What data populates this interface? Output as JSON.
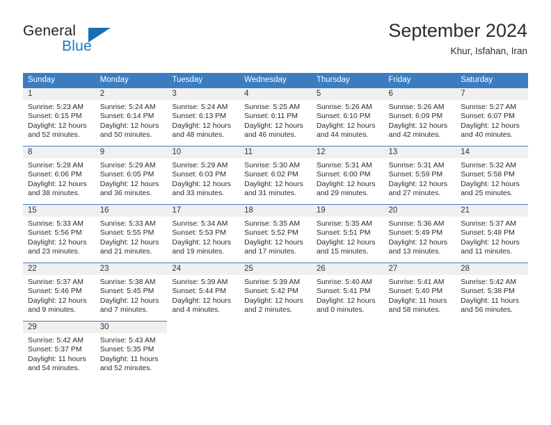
{
  "brand": {
    "name_part1": "General",
    "name_part2": "Blue",
    "triangle_color": "#1470b5",
    "blue_color": "#1579c6"
  },
  "header": {
    "title": "September 2024",
    "location": "Khur, Isfahan, Iran"
  },
  "theme": {
    "header_row_bg": "#3b7dc0",
    "header_row_text": "#ffffff",
    "daynum_band_bg": "#f0f0f0",
    "cell_border": "#3b7dc0",
    "body_text": "#2b2b2b"
  },
  "weekday_headers": [
    "Sunday",
    "Monday",
    "Tuesday",
    "Wednesday",
    "Thursday",
    "Friday",
    "Saturday"
  ],
  "weeks": [
    [
      {
        "day": "1",
        "sunrise": "Sunrise: 5:23 AM",
        "sunset": "Sunset: 6:15 PM",
        "daylight_line1": "Daylight: 12 hours",
        "daylight_line2": "and 52 minutes."
      },
      {
        "day": "2",
        "sunrise": "Sunrise: 5:24 AM",
        "sunset": "Sunset: 6:14 PM",
        "daylight_line1": "Daylight: 12 hours",
        "daylight_line2": "and 50 minutes."
      },
      {
        "day": "3",
        "sunrise": "Sunrise: 5:24 AM",
        "sunset": "Sunset: 6:13 PM",
        "daylight_line1": "Daylight: 12 hours",
        "daylight_line2": "and 48 minutes."
      },
      {
        "day": "4",
        "sunrise": "Sunrise: 5:25 AM",
        "sunset": "Sunset: 6:11 PM",
        "daylight_line1": "Daylight: 12 hours",
        "daylight_line2": "and 46 minutes."
      },
      {
        "day": "5",
        "sunrise": "Sunrise: 5:26 AM",
        "sunset": "Sunset: 6:10 PM",
        "daylight_line1": "Daylight: 12 hours",
        "daylight_line2": "and 44 minutes."
      },
      {
        "day": "6",
        "sunrise": "Sunrise: 5:26 AM",
        "sunset": "Sunset: 6:09 PM",
        "daylight_line1": "Daylight: 12 hours",
        "daylight_line2": "and 42 minutes."
      },
      {
        "day": "7",
        "sunrise": "Sunrise: 5:27 AM",
        "sunset": "Sunset: 6:07 PM",
        "daylight_line1": "Daylight: 12 hours",
        "daylight_line2": "and 40 minutes."
      }
    ],
    [
      {
        "day": "8",
        "sunrise": "Sunrise: 5:28 AM",
        "sunset": "Sunset: 6:06 PM",
        "daylight_line1": "Daylight: 12 hours",
        "daylight_line2": "and 38 minutes."
      },
      {
        "day": "9",
        "sunrise": "Sunrise: 5:29 AM",
        "sunset": "Sunset: 6:05 PM",
        "daylight_line1": "Daylight: 12 hours",
        "daylight_line2": "and 36 minutes."
      },
      {
        "day": "10",
        "sunrise": "Sunrise: 5:29 AM",
        "sunset": "Sunset: 6:03 PM",
        "daylight_line1": "Daylight: 12 hours",
        "daylight_line2": "and 33 minutes."
      },
      {
        "day": "11",
        "sunrise": "Sunrise: 5:30 AM",
        "sunset": "Sunset: 6:02 PM",
        "daylight_line1": "Daylight: 12 hours",
        "daylight_line2": "and 31 minutes."
      },
      {
        "day": "12",
        "sunrise": "Sunrise: 5:31 AM",
        "sunset": "Sunset: 6:00 PM",
        "daylight_line1": "Daylight: 12 hours",
        "daylight_line2": "and 29 minutes."
      },
      {
        "day": "13",
        "sunrise": "Sunrise: 5:31 AM",
        "sunset": "Sunset: 5:59 PM",
        "daylight_line1": "Daylight: 12 hours",
        "daylight_line2": "and 27 minutes."
      },
      {
        "day": "14",
        "sunrise": "Sunrise: 5:32 AM",
        "sunset": "Sunset: 5:58 PM",
        "daylight_line1": "Daylight: 12 hours",
        "daylight_line2": "and 25 minutes."
      }
    ],
    [
      {
        "day": "15",
        "sunrise": "Sunrise: 5:33 AM",
        "sunset": "Sunset: 5:56 PM",
        "daylight_line1": "Daylight: 12 hours",
        "daylight_line2": "and 23 minutes."
      },
      {
        "day": "16",
        "sunrise": "Sunrise: 5:33 AM",
        "sunset": "Sunset: 5:55 PM",
        "daylight_line1": "Daylight: 12 hours",
        "daylight_line2": "and 21 minutes."
      },
      {
        "day": "17",
        "sunrise": "Sunrise: 5:34 AM",
        "sunset": "Sunset: 5:53 PM",
        "daylight_line1": "Daylight: 12 hours",
        "daylight_line2": "and 19 minutes."
      },
      {
        "day": "18",
        "sunrise": "Sunrise: 5:35 AM",
        "sunset": "Sunset: 5:52 PM",
        "daylight_line1": "Daylight: 12 hours",
        "daylight_line2": "and 17 minutes."
      },
      {
        "day": "19",
        "sunrise": "Sunrise: 5:35 AM",
        "sunset": "Sunset: 5:51 PM",
        "daylight_line1": "Daylight: 12 hours",
        "daylight_line2": "and 15 minutes."
      },
      {
        "day": "20",
        "sunrise": "Sunrise: 5:36 AM",
        "sunset": "Sunset: 5:49 PM",
        "daylight_line1": "Daylight: 12 hours",
        "daylight_line2": "and 13 minutes."
      },
      {
        "day": "21",
        "sunrise": "Sunrise: 5:37 AM",
        "sunset": "Sunset: 5:48 PM",
        "daylight_line1": "Daylight: 12 hours",
        "daylight_line2": "and 11 minutes."
      }
    ],
    [
      {
        "day": "22",
        "sunrise": "Sunrise: 5:37 AM",
        "sunset": "Sunset: 5:46 PM",
        "daylight_line1": "Daylight: 12 hours",
        "daylight_line2": "and 9 minutes."
      },
      {
        "day": "23",
        "sunrise": "Sunrise: 5:38 AM",
        "sunset": "Sunset: 5:45 PM",
        "daylight_line1": "Daylight: 12 hours",
        "daylight_line2": "and 7 minutes."
      },
      {
        "day": "24",
        "sunrise": "Sunrise: 5:39 AM",
        "sunset": "Sunset: 5:44 PM",
        "daylight_line1": "Daylight: 12 hours",
        "daylight_line2": "and 4 minutes."
      },
      {
        "day": "25",
        "sunrise": "Sunrise: 5:39 AM",
        "sunset": "Sunset: 5:42 PM",
        "daylight_line1": "Daylight: 12 hours",
        "daylight_line2": "and 2 minutes."
      },
      {
        "day": "26",
        "sunrise": "Sunrise: 5:40 AM",
        "sunset": "Sunset: 5:41 PM",
        "daylight_line1": "Daylight: 12 hours",
        "daylight_line2": "and 0 minutes."
      },
      {
        "day": "27",
        "sunrise": "Sunrise: 5:41 AM",
        "sunset": "Sunset: 5:40 PM",
        "daylight_line1": "Daylight: 11 hours",
        "daylight_line2": "and 58 minutes."
      },
      {
        "day": "28",
        "sunrise": "Sunrise: 5:42 AM",
        "sunset": "Sunset: 5:38 PM",
        "daylight_line1": "Daylight: 11 hours",
        "daylight_line2": "and 56 minutes."
      }
    ],
    [
      {
        "day": "29",
        "sunrise": "Sunrise: 5:42 AM",
        "sunset": "Sunset: 5:37 PM",
        "daylight_line1": "Daylight: 11 hours",
        "daylight_line2": "and 54 minutes."
      },
      {
        "day": "30",
        "sunrise": "Sunrise: 5:43 AM",
        "sunset": "Sunset: 5:35 PM",
        "daylight_line1": "Daylight: 11 hours",
        "daylight_line2": "and 52 minutes."
      },
      null,
      null,
      null,
      null,
      null
    ]
  ]
}
